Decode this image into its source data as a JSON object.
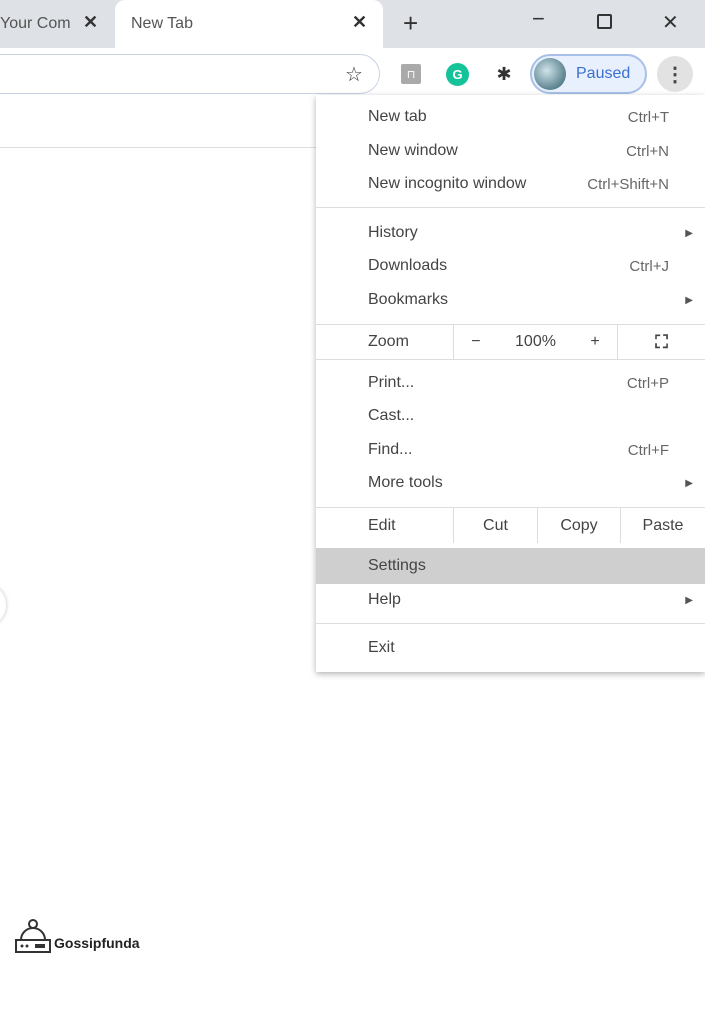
{
  "tabs": [
    {
      "label": "Your Com"
    },
    {
      "label": "New Tab"
    }
  ],
  "toolbar": {
    "profile_label": "Paused"
  },
  "menu": {
    "items": [
      {
        "label": "New tab",
        "shortcut": "Ctrl+T"
      },
      {
        "label": "New window",
        "shortcut": "Ctrl+N"
      },
      {
        "label": "New incognito window",
        "shortcut": "Ctrl+Shift+N"
      },
      {
        "label": "History",
        "submenu": true
      },
      {
        "label": "Downloads",
        "shortcut": "Ctrl+J"
      },
      {
        "label": "Bookmarks",
        "submenu": true
      },
      {
        "label": "Print...",
        "shortcut": "Ctrl+P"
      },
      {
        "label": "Cast..."
      },
      {
        "label": "Find...",
        "shortcut": "Ctrl+F"
      },
      {
        "label": "More tools",
        "submenu": true
      },
      {
        "label": "Settings",
        "highlighted": true
      },
      {
        "label": "Help",
        "submenu": true
      },
      {
        "label": "Exit"
      }
    ],
    "zoom": {
      "label": "Zoom",
      "minus": "−",
      "value": "100%",
      "plus": "+"
    },
    "edit": {
      "label": "Edit",
      "cut": "Cut",
      "copy": "Copy",
      "paste": "Paste"
    }
  },
  "watermark": {
    "text": "Gossipfunda"
  }
}
